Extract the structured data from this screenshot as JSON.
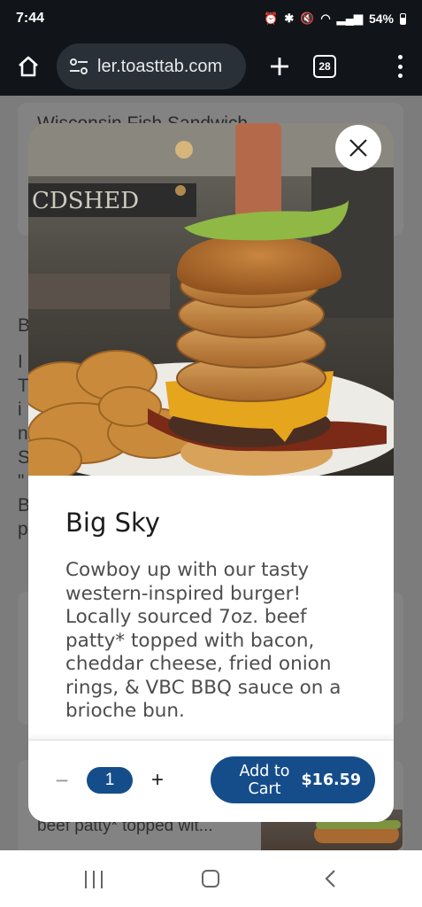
{
  "status_bar": {
    "time": "7:44",
    "battery": "54%"
  },
  "browser": {
    "url": "ler.toasttab.com",
    "tab_count": "28"
  },
  "background_page": {
    "item_title": "Wisconsin Fish Sandwich",
    "snippet": "beef patty* topped wit...",
    "side_letters": [
      "B",
      "",
      "I",
      "T",
      "i",
      "n",
      "S",
      "\"",
      "B",
      "p"
    ]
  },
  "modal": {
    "item_name": "Big Sky",
    "description": "Cowboy up with our tasty western-inspired burger! Locally sourced 7oz. beef patty* topped with bacon, cheddar cheese, fried onion rings, & VBC BBQ sauce on a brioche bun.",
    "quantity": "1",
    "minus_label": "−",
    "plus_label": "+",
    "add_to_cart_label": "Add to Cart",
    "price": "$16.59"
  },
  "colors": {
    "accent": "#154d8a",
    "status_bar": "#111418"
  },
  "icons": [
    "home-icon",
    "site-settings-icon",
    "new-tab-icon",
    "tabs-icon",
    "overflow-menu-icon",
    "close-icon",
    "recents-icon",
    "home-nav-icon",
    "back-icon"
  ]
}
